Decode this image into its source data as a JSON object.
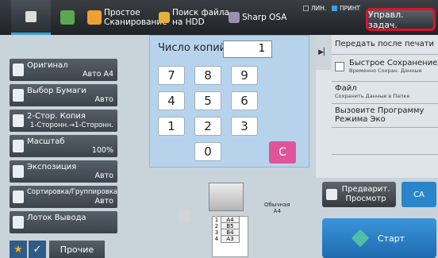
{
  "topbar": {
    "home_icon": "home-icon",
    "items": [
      {
        "label": "",
        "icon": "app-icon"
      },
      {
        "label": "Простое Сканирование",
        "icon": "scan-icon"
      },
      {
        "label": "Поиск файла на HDD",
        "icon": "folder-search-icon"
      },
      {
        "label": "Sharp OSA",
        "icon": "osa-icon"
      }
    ],
    "job_status": [
      "ЛИН.",
      "ПРИНТ"
    ],
    "job_button": "Управл. задач."
  },
  "functions": [
    {
      "name": "Оригинал",
      "value": "Авто  A4",
      "icon": "original-icon"
    },
    {
      "name": "Выбор Бумаги",
      "value": "Авто",
      "icon": "paper-icon"
    },
    {
      "name": "2-Стор. Копия",
      "value": "1-Сторонн.→1-Сторонн.",
      "icon": "duplex-icon"
    },
    {
      "name": "Масштаб",
      "value": "100%",
      "icon": "zoom-icon"
    },
    {
      "name": "Экспозиция",
      "value": "Авто",
      "icon": "exposure-icon"
    },
    {
      "name": "Сортировка/Группировка",
      "value": "Авто",
      "icon": "sort-icon"
    },
    {
      "name": "Лоток Вывода",
      "value": "",
      "icon": "tray-icon"
    }
  ],
  "bottom_left": {
    "other_label": "Прочие"
  },
  "keypad": {
    "copies_label": "Число копий",
    "copies_value": "1",
    "keys": [
      "7",
      "8",
      "9",
      "4",
      "5",
      "6",
      "1",
      "2",
      "3",
      "0"
    ],
    "clear_label": "C"
  },
  "right_panel": {
    "send_after_print": "Передать после печати",
    "quick_save": "Быстрое Сохранение",
    "quick_save_sub": "Временно Сохран. Данные",
    "file": "Файл",
    "file_sub": "Сохранить Данные в Папке",
    "eco_line1": "Вызовите Программу",
    "eco_line2": "Режима Эко"
  },
  "preview": {
    "paper_type": "Обычная",
    "paper_size": "A4",
    "trays": [
      {
        "num": "1",
        "size": "A4"
      },
      {
        "num": "2",
        "size": "B5"
      },
      {
        "num": "3",
        "size": "B4"
      },
      {
        "num": "4",
        "size": "A3"
      }
    ]
  },
  "actions": {
    "preview_line1": "Предварит.",
    "preview_line2": "Просмотр",
    "ca": "CA",
    "start": "Старт"
  },
  "colors": {
    "accent": "#2a84c9",
    "clear": "#e0549a",
    "highlight_border": "#e0102a"
  }
}
